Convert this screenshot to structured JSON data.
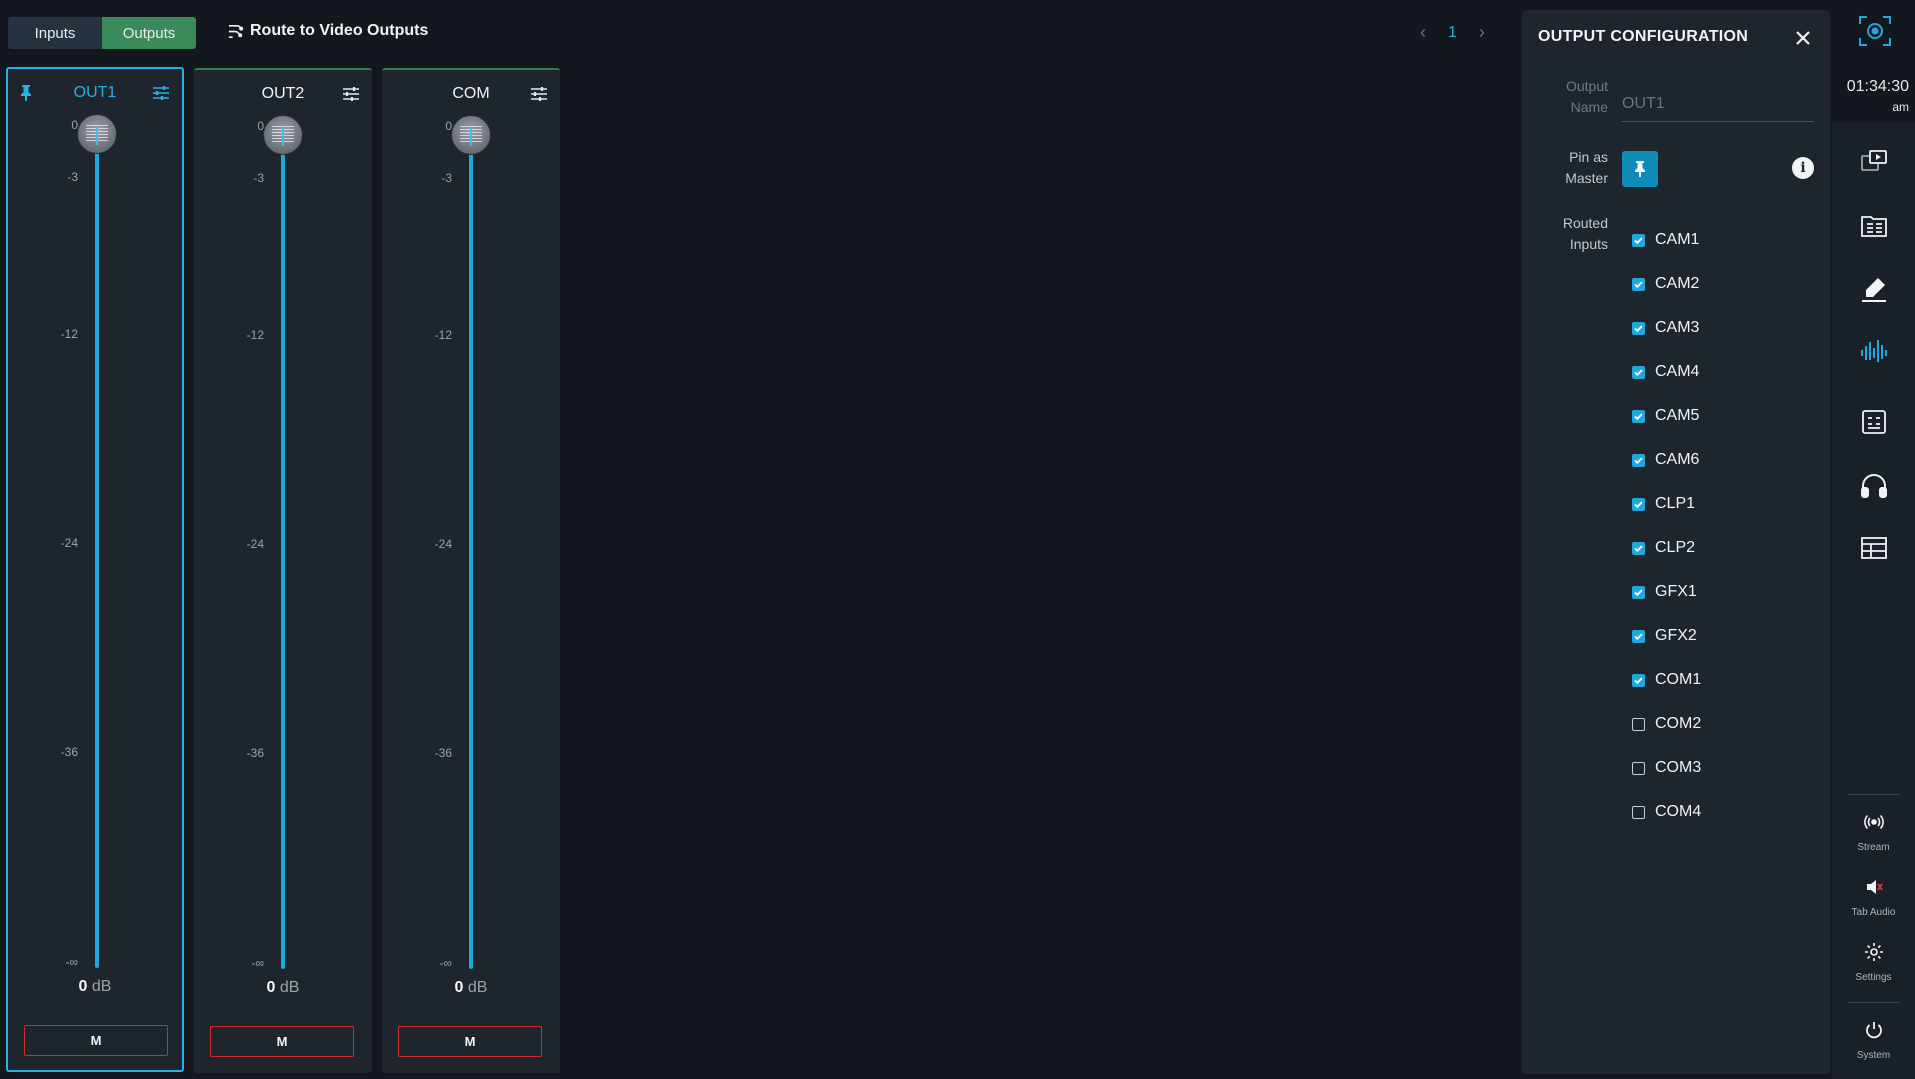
{
  "tabs": {
    "inputs": "Inputs",
    "outputs": "Outputs"
  },
  "route_button": "Route to Video Outputs",
  "pager": {
    "page": "1",
    "prev": "‹",
    "next": "›"
  },
  "scale": {
    "s0": "0",
    "s3": "-3",
    "s12": "-12",
    "s24": "-24",
    "s36": "-36",
    "sinf": "-∞"
  },
  "strips": [
    {
      "name": "OUT1",
      "db_value": "0",
      "db_unit": "dB",
      "mute": "M",
      "level_db": 0
    },
    {
      "name": "OUT2",
      "db_value": "0",
      "db_unit": "dB",
      "mute": "M",
      "level_db": 0
    },
    {
      "name": "COM",
      "db_value": "0",
      "db_unit": "dB",
      "mute": "M",
      "level_db": 0
    }
  ],
  "panel": {
    "title": "OUTPUT CONFIGURATION",
    "output_name_label": "Output Name",
    "output_name_placeholder": "OUT1",
    "pin_label": "Pin as Master",
    "routed_label": "Routed Inputs",
    "info_glyph": "i",
    "routes": [
      {
        "name": "CAM1",
        "checked": true
      },
      {
        "name": "CAM2",
        "checked": true
      },
      {
        "name": "CAM3",
        "checked": true
      },
      {
        "name": "CAM4",
        "checked": true
      },
      {
        "name": "CAM5",
        "checked": true
      },
      {
        "name": "CAM6",
        "checked": true
      },
      {
        "name": "CLP1",
        "checked": true
      },
      {
        "name": "CLP2",
        "checked": true
      },
      {
        "name": "GFX1",
        "checked": true
      },
      {
        "name": "GFX2",
        "checked": true
      },
      {
        "name": "COM1",
        "checked": true
      },
      {
        "name": "COM2",
        "checked": false
      },
      {
        "name": "COM3",
        "checked": false
      },
      {
        "name": "COM4",
        "checked": false
      }
    ]
  },
  "rail": {
    "time": "01:34:30",
    "ampm": "am",
    "stream": "Stream",
    "tab_audio": "Tab Audio",
    "settings": "Settings",
    "system": "System"
  },
  "colors": {
    "accent": "#1fa8dc",
    "outputs_tab": "#3b8a5a",
    "mute_border": "#d42a2a"
  }
}
